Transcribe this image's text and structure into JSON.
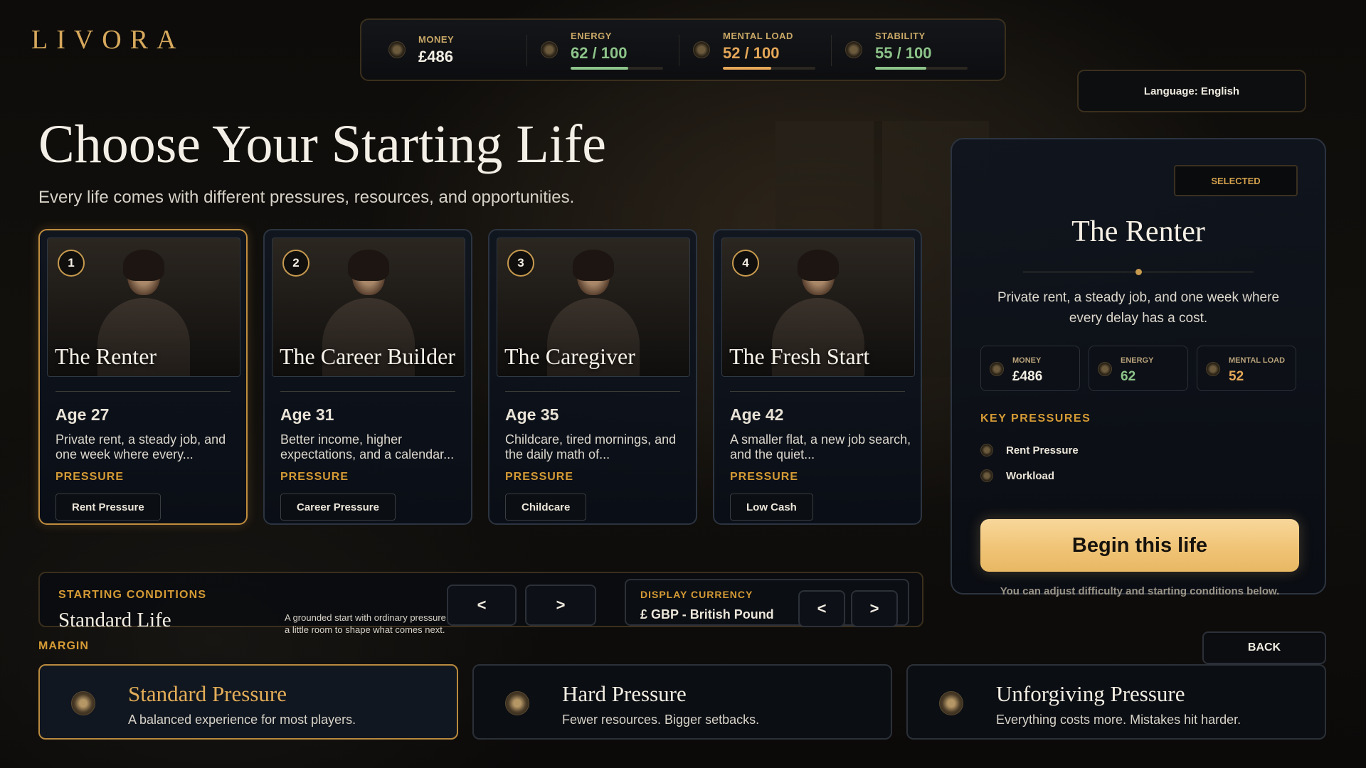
{
  "app": {
    "logo": "LIVORA"
  },
  "stats": [
    {
      "label": "MONEY",
      "value": "£486",
      "icon": "coin-icon",
      "color": "#f2ede3",
      "meter": null
    },
    {
      "label": "ENERGY",
      "value": "62 / 100",
      "icon": "energy-icon",
      "color": "#8dc48a",
      "meter": 0.62,
      "meter_color": "#8dc48a"
    },
    {
      "label": "MENTAL LOAD",
      "value": "52 / 100",
      "icon": "brain-icon",
      "color": "#e4a758",
      "meter": 0.52,
      "meter_color": "#e4a758"
    },
    {
      "label": "STABILITY",
      "value": "55 / 100",
      "icon": "house-icon",
      "color": "#8dc48a",
      "meter": 0.55,
      "meter_color": "#8dc48a"
    }
  ],
  "language_button": "Language: English",
  "title": "Choose Your Starting Life",
  "subtitle": "Every life comes with different pressures, resources, and opportunities.",
  "cards": [
    {
      "num": "1",
      "name": "The Renter",
      "age": "Age 27",
      "desc": "Private rent, a steady job, and one week where every...",
      "pressure_label": "PRESSURE",
      "tag": "Rent Pressure"
    },
    {
      "num": "2",
      "name": "The Career Builder",
      "age": "Age 31",
      "desc": "Better income, higher expectations, and a calendar...",
      "pressure_label": "PRESSURE",
      "tag": "Career Pressure"
    },
    {
      "num": "3",
      "name": "The Caregiver",
      "age": "Age 35",
      "desc": "Childcare, tired mornings, and the daily math of...",
      "pressure_label": "PRESSURE",
      "tag": "Childcare"
    },
    {
      "num": "4",
      "name": "The Fresh Start",
      "age": "Age 42",
      "desc": "A smaller flat, a new job search, and the quiet...",
      "pressure_label": "PRESSURE",
      "tag": "Low Cash"
    }
  ],
  "panel": {
    "badge": "SELECTED",
    "title": "The Renter",
    "desc": "Private rent, a steady job, and one week where every delay has a cost.",
    "mini_stats": [
      {
        "label": "MONEY",
        "value": "£486",
        "color": "#f2ede3",
        "icon": "coin-icon"
      },
      {
        "label": "ENERGY",
        "value": "62",
        "color": "#8dc48a",
        "icon": "energy-icon"
      },
      {
        "label": "MENTAL LOAD",
        "value": "52",
        "color": "#e4a758",
        "icon": "brain-icon"
      }
    ],
    "key_pressures_title": "KEY PRESSURES",
    "key_pressures": [
      "Rent Pressure",
      "Workload"
    ],
    "begin_button": "Begin this life",
    "note": "You can adjust difficulty and starting conditions below."
  },
  "conditions": {
    "label": "STARTING CONDITIONS",
    "value": "Standard Life",
    "desc": "A grounded start with ordinary pressure and a little room to shape what comes next.",
    "prev": "<",
    "next": ">"
  },
  "currency": {
    "label": "DISPLAY CURRENCY",
    "value": "£ GBP - British Pound",
    "prev": "<",
    "next": ">"
  },
  "margin_label": "MARGIN",
  "back_button": "BACK",
  "difficulties": [
    {
      "name": "Standard Pressure",
      "desc": "A balanced experience for most players.",
      "selected": true
    },
    {
      "name": "Hard Pressure",
      "desc": "Fewer resources. Bigger setbacks.",
      "selected": false
    },
    {
      "name": "Unforgiving Pressure",
      "desc": "Everything costs more. Mistakes hit harder.",
      "selected": false
    }
  ]
}
